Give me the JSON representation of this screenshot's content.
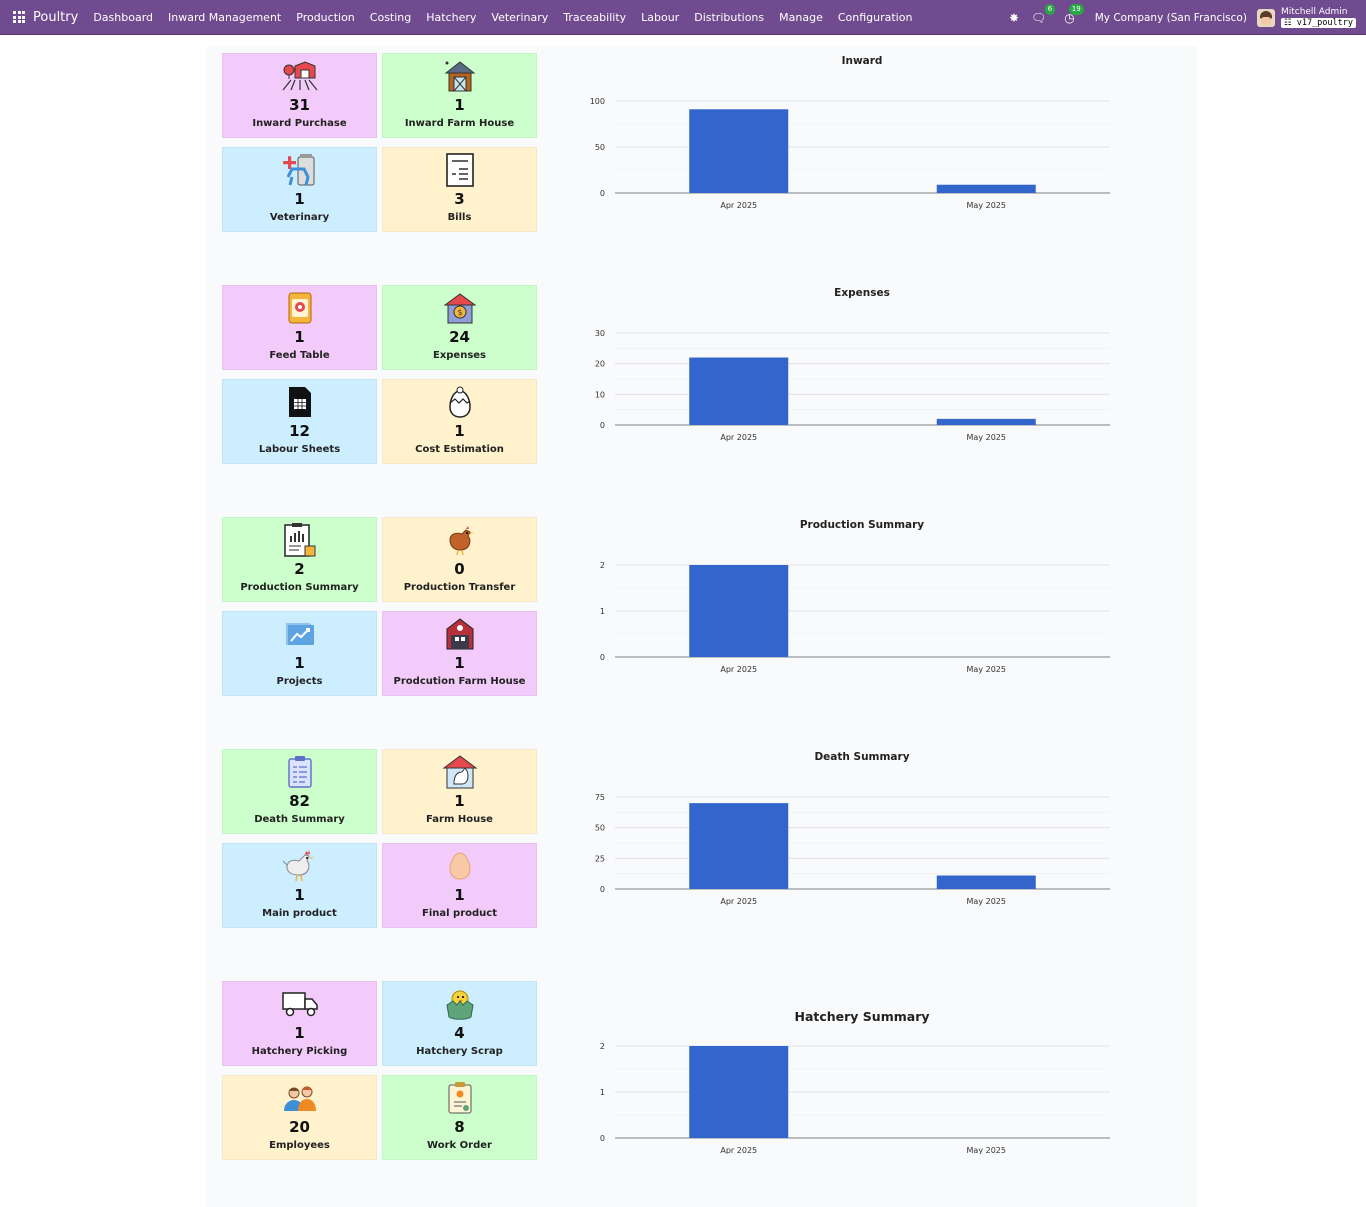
{
  "navbar": {
    "brand": "Poultry",
    "menu": [
      "Dashboard",
      "Inward Management",
      "Production",
      "Costing",
      "Hatchery",
      "Veterinary",
      "Traceability",
      "Labour",
      "Distributions",
      "Manage",
      "Configuration"
    ],
    "messages_count": "6",
    "activities_count": "19",
    "company": "My Company (San Francisco)",
    "user_name": "Mitchell Admin",
    "db_name": "v17_poultry"
  },
  "sections": [
    {
      "cards": [
        {
          "value": "31",
          "label": "Inward Purchase",
          "color": "pink",
          "icon": "farm-barn-icon"
        },
        {
          "value": "1",
          "label": "Inward Farm House",
          "color": "green",
          "icon": "farm-house-icon"
        },
        {
          "value": "1",
          "label": "Veterinary",
          "color": "blue",
          "icon": "veterinary-icon"
        },
        {
          "value": "3",
          "label": "Bills",
          "color": "yellow",
          "icon": "bill-icon"
        }
      ],
      "chart_index": 0
    },
    {
      "cards": [
        {
          "value": "1",
          "label": "Feed Table",
          "color": "pink",
          "icon": "feed-bag-icon"
        },
        {
          "value": "24",
          "label": "Expenses",
          "color": "green",
          "icon": "expenses-icon"
        },
        {
          "value": "12",
          "label": "Labour Sheets",
          "color": "blue",
          "icon": "sheet-icon"
        },
        {
          "value": "1",
          "label": "Cost Estimation",
          "color": "yellow",
          "icon": "chick-egg-icon"
        }
      ],
      "chart_index": 1
    },
    {
      "cards": [
        {
          "value": "2",
          "label": "Production Summary",
          "color": "green",
          "icon": "report-icon"
        },
        {
          "value": "0",
          "label": "Production Transfer",
          "color": "yellow",
          "icon": "hen-icon"
        },
        {
          "value": "1",
          "label": "Projects",
          "color": "blue",
          "icon": "projects-chart-icon"
        },
        {
          "value": "1",
          "label": "Prodcution Farm House",
          "color": "pink",
          "icon": "red-barn-icon"
        }
      ],
      "chart_index": 2
    },
    {
      "cards": [
        {
          "value": "82",
          "label": "Death Summary",
          "color": "green",
          "icon": "clipboard-icon"
        },
        {
          "value": "1",
          "label": "Farm House",
          "color": "yellow",
          "icon": "rooster-house-icon"
        },
        {
          "value": "1",
          "label": "Main product",
          "color": "blue",
          "icon": "chicken-icon"
        },
        {
          "value": "1",
          "label": "Final product",
          "color": "pink",
          "icon": "egg-icon"
        }
      ],
      "chart_index": 3
    },
    {
      "cards": [
        {
          "value": "1",
          "label": "Hatchery Picking",
          "color": "pink",
          "icon": "truck-icon"
        },
        {
          "value": "4",
          "label": "Hatchery Scrap",
          "color": "blue",
          "icon": "hatched-chick-icon"
        },
        {
          "value": "20",
          "label": "Employees",
          "color": "yellow",
          "icon": "employees-icon"
        },
        {
          "value": "8",
          "label": "Work Order",
          "color": "green",
          "icon": "work-order-icon"
        }
      ],
      "chart_index": 4
    }
  ],
  "chart_data": [
    {
      "type": "bar",
      "title": "Inward",
      "categories": [
        "Apr 2025",
        "May 2025"
      ],
      "values": [
        91,
        9
      ],
      "yticks": [
        0,
        50,
        100
      ],
      "ylim": [
        0,
        100
      ],
      "bar_color": "#3366cc",
      "grid": true
    },
    {
      "type": "bar",
      "title": "Expenses",
      "categories": [
        "Apr 2025",
        "May 2025"
      ],
      "values": [
        22,
        2
      ],
      "yticks": [
        0,
        10,
        20,
        30
      ],
      "ylim": [
        0,
        30
      ],
      "bar_color": "#3366cc",
      "grid": true
    },
    {
      "type": "bar",
      "title": "Production Summary",
      "categories": [
        "Apr 2025",
        "May 2025"
      ],
      "values": [
        2,
        0
      ],
      "yticks": [
        0,
        1,
        2
      ],
      "ylim": [
        0,
        2
      ],
      "bar_color": "#3366cc",
      "grid": true
    },
    {
      "type": "bar",
      "title": "Death Summary",
      "categories": [
        "Apr 2025",
        "May 2025"
      ],
      "values": [
        70,
        11
      ],
      "yticks": [
        0,
        25,
        50,
        75
      ],
      "ylim": [
        0,
        75
      ],
      "bar_color": "#3366cc",
      "grid": true
    },
    {
      "type": "bar",
      "title": "Hatchery Summary",
      "categories": [
        "Apr 2025",
        "May 2025"
      ],
      "values": [
        2,
        0
      ],
      "yticks": [
        0,
        1,
        2
      ],
      "ylim": [
        0,
        2
      ],
      "bar_color": "#3366cc",
      "grid": true
    }
  ]
}
